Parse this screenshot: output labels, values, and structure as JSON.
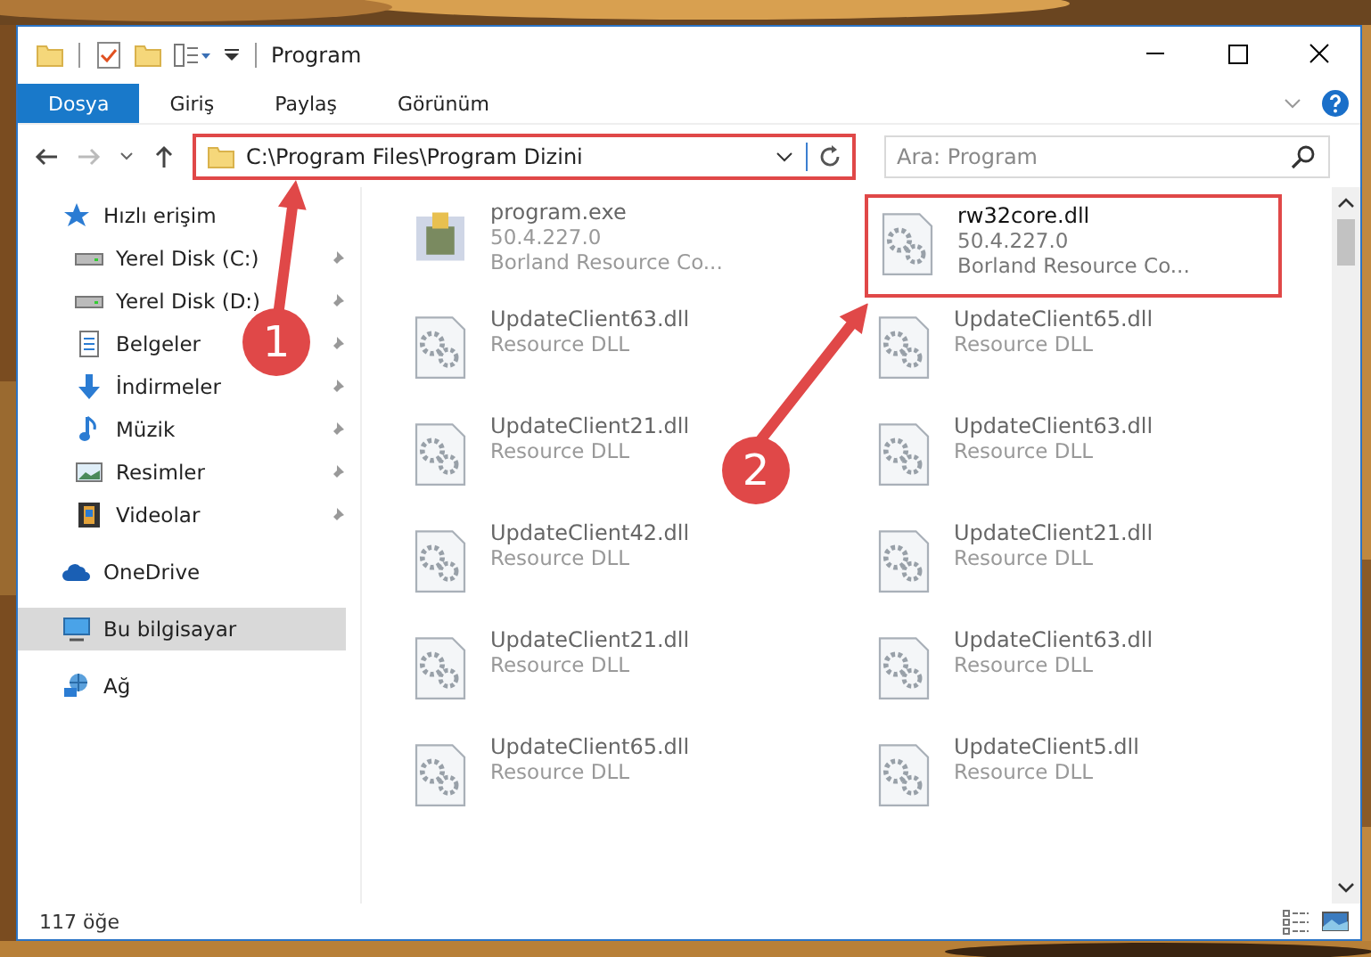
{
  "window": {
    "title": "Program"
  },
  "ribbon_tabs": [
    {
      "label": "Dosya",
      "selected": true
    },
    {
      "label": "Giriş",
      "selected": false
    },
    {
      "label": "Paylaş",
      "selected": false
    },
    {
      "label": "Görünüm",
      "selected": false
    }
  ],
  "address": {
    "value": "C:\\Program Files\\Program Dizini",
    "highlighted": true
  },
  "search": {
    "placeholder": "Ara: Program"
  },
  "sidebar": {
    "items": [
      {
        "label": "Hızlı erişim",
        "kind": "star",
        "selected": false,
        "children": [
          {
            "label": "Yerel Disk (C:)",
            "kind": "drive",
            "pinned": true,
            "selected": false
          },
          {
            "label": "Yerel Disk (D:)",
            "kind": "drive",
            "pinned": true,
            "selected": false
          },
          {
            "label": "Belgeler",
            "kind": "document",
            "pinned": true,
            "selected": false
          },
          {
            "label": "İndirmeler",
            "kind": "download",
            "pinned": true,
            "selected": false
          },
          {
            "label": "Müzik",
            "kind": "music",
            "pinned": true,
            "selected": false
          },
          {
            "label": "Resimler",
            "kind": "pictures",
            "pinned": true,
            "selected": false
          },
          {
            "label": "Videolar",
            "kind": "video",
            "pinned": true,
            "selected": false
          }
        ]
      },
      {
        "label": "OneDrive",
        "kind": "cloud",
        "selected": false
      },
      {
        "label": "Bu bilgisayar",
        "kind": "computer",
        "selected": true
      },
      {
        "label": "Ağ",
        "kind": "network",
        "selected": false
      }
    ]
  },
  "files": [
    {
      "name": "program.exe",
      "details": [
        "50.4.227.0",
        "Borland Resource Co..."
      ],
      "kind": "exe",
      "faded": true,
      "highlighted": false
    },
    {
      "name": "rw32core.dll",
      "details": [
        "50.4.227.0",
        "Borland Resource Co..."
      ],
      "kind": "dll",
      "faded": false,
      "highlighted": true
    },
    {
      "name": "UpdateClient63.dll",
      "details": [
        "Resource DLL"
      ],
      "kind": "dll",
      "faded": true,
      "highlighted": false
    },
    {
      "name": "UpdateClient65.dll",
      "details": [
        "Resource DLL"
      ],
      "kind": "dll",
      "faded": true,
      "highlighted": false
    },
    {
      "name": "UpdateClient21.dll",
      "details": [
        "Resource DLL"
      ],
      "kind": "dll",
      "faded": true,
      "highlighted": false
    },
    {
      "name": "UpdateClient63.dll",
      "details": [
        "Resource DLL"
      ],
      "kind": "dll",
      "faded": true,
      "highlighted": false
    },
    {
      "name": "UpdateClient42.dll",
      "details": [
        "Resource DLL"
      ],
      "kind": "dll",
      "faded": true,
      "highlighted": false
    },
    {
      "name": "UpdateClient21.dll",
      "details": [
        "Resource DLL"
      ],
      "kind": "dll",
      "faded": true,
      "highlighted": false
    },
    {
      "name": "UpdateClient21.dll",
      "details": [
        "Resource DLL"
      ],
      "kind": "dll",
      "faded": true,
      "highlighted": false
    },
    {
      "name": "UpdateClient63.dll",
      "details": [
        "Resource DLL"
      ],
      "kind": "dll",
      "faded": true,
      "highlighted": false
    },
    {
      "name": "UpdateClient65.dll",
      "details": [
        "Resource DLL"
      ],
      "kind": "dll",
      "faded": true,
      "highlighted": false
    },
    {
      "name": "UpdateClient5.dll",
      "details": [
        "Resource DLL"
      ],
      "kind": "dll",
      "faded": true,
      "highlighted": false
    }
  ],
  "status_bar": {
    "count": "117 öğe"
  },
  "annotations": [
    {
      "number": "1"
    },
    {
      "number": "2"
    }
  ]
}
